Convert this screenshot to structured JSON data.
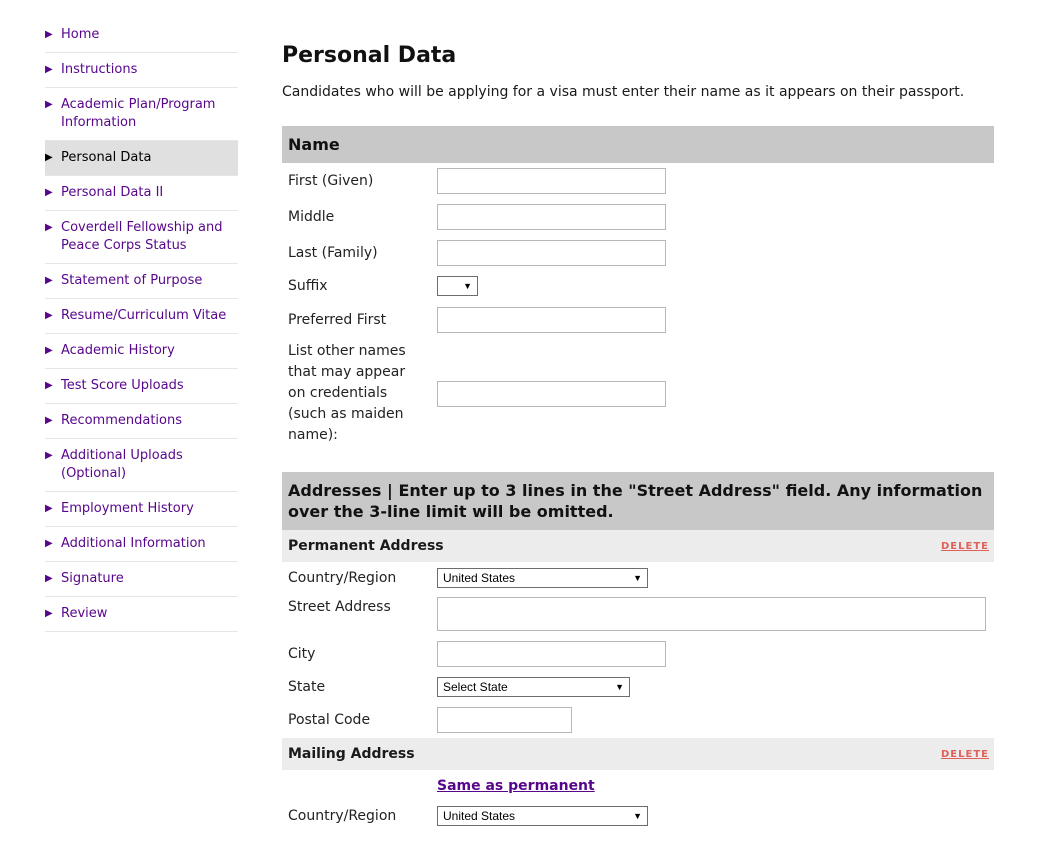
{
  "sidebar": {
    "items": [
      {
        "label": "Home",
        "active": false
      },
      {
        "label": "Instructions",
        "active": false
      },
      {
        "label": "Academic Plan/Program Information",
        "active": false
      },
      {
        "label": "Personal Data",
        "active": true
      },
      {
        "label": "Personal Data II",
        "active": false
      },
      {
        "label": "Coverdell Fellowship and Peace Corps Status",
        "active": false
      },
      {
        "label": "Statement of Purpose",
        "active": false
      },
      {
        "label": "Resume/Curriculum Vitae",
        "active": false
      },
      {
        "label": "Academic History",
        "active": false
      },
      {
        "label": "Test Score Uploads",
        "active": false
      },
      {
        "label": "Recommendations",
        "active": false
      },
      {
        "label": "Additional Uploads (Optional)",
        "active": false
      },
      {
        "label": "Employment History",
        "active": false
      },
      {
        "label": "Additional Information",
        "active": false
      },
      {
        "label": "Signature",
        "active": false
      },
      {
        "label": "Review",
        "active": false
      }
    ]
  },
  "page": {
    "title": "Personal Data",
    "intro": "Candidates who will be applying for a visa must enter their name as it appears on their passport."
  },
  "name_section": {
    "title": "Name",
    "first_label": "First (Given)",
    "first_value": "",
    "middle_label": "Middle",
    "middle_value": "",
    "last_label": "Last (Family)",
    "last_value": "",
    "suffix_label": "Suffix",
    "suffix_value": "",
    "preferred_label": "Preferred First",
    "preferred_value": "",
    "other_names_label": "List other names that may appear on credentials (such as maiden name):",
    "other_names_value": ""
  },
  "address_section": {
    "title": "Addresses | Enter up to 3 lines in the \"Street Address\" field. Any information over the 3-line limit will be omitted.",
    "permanent": {
      "title": "Permanent Address",
      "delete_label": "DELETE",
      "country_label": "Country/Region",
      "country_value": "United States",
      "street_label": "Street Address",
      "street_value": "",
      "city_label": "City",
      "city_value": "",
      "state_label": "State",
      "state_value": "Select State",
      "postal_label": "Postal Code",
      "postal_value": ""
    },
    "mailing": {
      "title": "Mailing Address",
      "delete_label": "DELETE",
      "same_link": "Same as permanent",
      "country_label": "Country/Region",
      "country_value": "United States"
    }
  },
  "colors": {
    "brand_purple": "#57068c",
    "header_gray": "#c8c8c8",
    "subheader_gray": "#ececec",
    "delete_red": "#e0605a"
  }
}
